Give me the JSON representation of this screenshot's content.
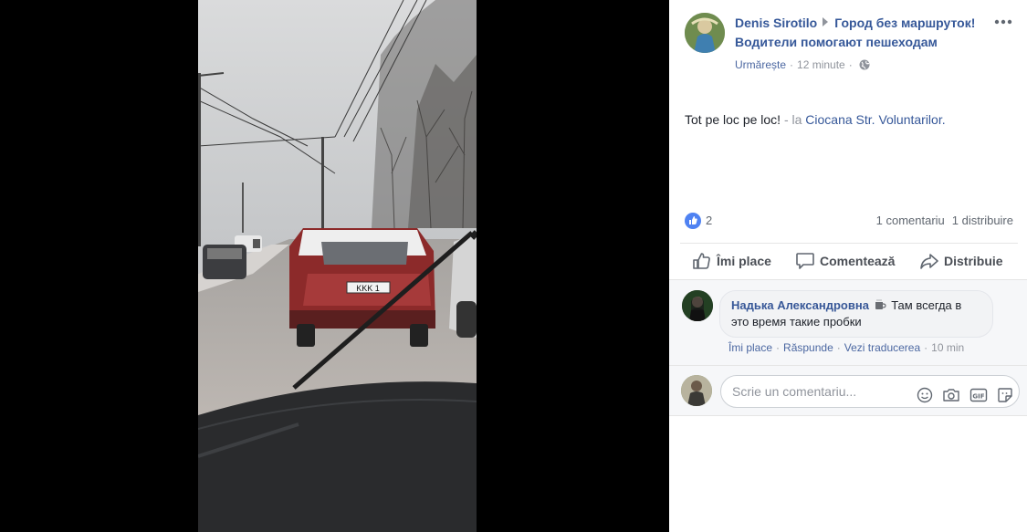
{
  "post": {
    "author": "Denis Sirotilo",
    "group": "Город без маршруток! Водители помогают пешеходам",
    "follow_label": "Urmărește",
    "time": "12 minute",
    "text": "Tot pe loc pe loc!",
    "at_word": "- la",
    "place": "Ciocana Str. Voluntarilor."
  },
  "stats": {
    "like_count": "2",
    "comments": "1 comentariu",
    "shares": "1 distribuire"
  },
  "actions": {
    "like": "Îmi place",
    "comment": "Comentează",
    "share": "Distribuie"
  },
  "comment": {
    "author": "Надька Александровна",
    "text": "Там всегда в это время такие пробки",
    "like": "Îmi place",
    "reply": "Răspunde",
    "translate": "Vezi traducerea",
    "time": "10 min"
  },
  "composer": {
    "placeholder": "Scrie un comentariu..."
  },
  "photo": {
    "plate": "KKK 1"
  },
  "colors": {
    "link": "#365899",
    "like_blue": "#4f82f2",
    "muted": "#90949c"
  }
}
